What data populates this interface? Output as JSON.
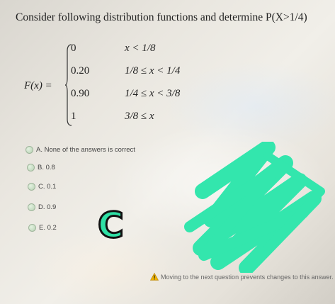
{
  "question": {
    "text": "Consider following distribution functions and determine P(X>1/4)"
  },
  "formula": {
    "label": "F(x) =",
    "cases": [
      {
        "value": "0",
        "condition": "x < 1/8"
      },
      {
        "value": "0.20",
        "condition": "1/8 ≤ x < 1/4"
      },
      {
        "value": "0.90",
        "condition": "1/4 ≤ x < 3/8"
      },
      {
        "value": "1",
        "condition": "3/8 ≤ x"
      }
    ]
  },
  "options": [
    {
      "label": "A. None of the answers is correct"
    },
    {
      "label": "B. 0.8"
    },
    {
      "label": "C. 0.1"
    },
    {
      "label": "D. 0.9"
    },
    {
      "label": "E. 0.2"
    }
  ],
  "handwritten_answer": "C",
  "warning": {
    "text": "Moving to the next question prevents changes to this answer.",
    "icon": "warning-triangle-icon"
  },
  "colors": {
    "scribble": "#33e6ad",
    "radio": "#c9dfc5"
  }
}
